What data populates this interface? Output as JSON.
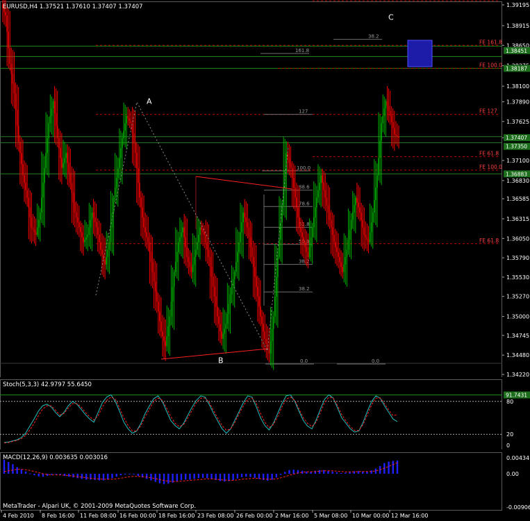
{
  "window": {
    "symbol_header": "EURUSD,H4  1.37521 1.37610 1.37407 1.37407",
    "copyright": "MetaTrader - Alpari UK, © 2001-2009 MetaQuotes Software Corp."
  },
  "colors": {
    "background": "#000000",
    "bull_candle": "#00b000",
    "bear_candle": "#ff0000",
    "grid": "#2a3a2a",
    "fib_red": "#c00000",
    "fib_gray": "#707070",
    "pattern_line": "#ff2020",
    "stoch_main": "#20c0c0",
    "stoch_signal": "#ff2020",
    "macd_hist": "#2020ff",
    "macd_signal": "#ff2020",
    "zone_box": "#1c1ca8",
    "axis_text": "#ffffff",
    "highlight_line": "#1e8c1e",
    "price_tag": "#1c6d1c"
  },
  "chart_data": [
    {
      "type": "candlestick",
      "title": "EURUSD,H4",
      "ohlc": {
        "open": 1.37521,
        "high": 1.3761,
        "low": 1.37407,
        "close": 1.37407
      },
      "ylim": [
        1.341,
        1.396
      ],
      "y_ticks": [
        "1.39195",
        "1.38915",
        "1.38650",
        "1.38375",
        "1.38100",
        "1.37890",
        "1.37625",
        "1.37407",
        "1.37100",
        "1.36830",
        "1.36585",
        "1.36315",
        "1.36050",
        "1.35790",
        "1.35530",
        "1.35270",
        "1.35000",
        "1.34745",
        "1.34480",
        "1.34220"
      ],
      "x_ticks": [
        "4 Feb 2010",
        "8 Feb 16:00",
        "11 Feb 08:00",
        "16 Feb 00:00",
        "18 Feb 16:00",
        "23 Feb 08:00",
        "26 Feb 00:00",
        "2 Mar 16:00",
        "5 Mar 08:00",
        "10 Mar 00:00",
        "12 Mar 16:00"
      ],
      "price_tags": [
        {
          "label": "1.38451",
          "price": 1.3858
        },
        {
          "label": "1.38187",
          "price": 1.3834
        },
        {
          "label": "1.37407",
          "price": 1.37407
        },
        {
          "label": "1.37350",
          "price": 1.3729
        },
        {
          "label": "1.36883",
          "price": 1.3692
        }
      ],
      "wave_labels": [
        {
          "label": "A",
          "price": 1.379
        },
        {
          "label": "B",
          "price": 1.3441
        },
        {
          "label": "C",
          "price": 1.3903
        }
      ],
      "fe_levels": [
        {
          "label": "FE 127",
          "price": 1.3925
        },
        {
          "label": "FE 161.8",
          "price": 1.3865
        },
        {
          "label": "FE 100.0",
          "price": 1.3834
        },
        {
          "label": "FE 127",
          "price": 1.3772
        },
        {
          "label": "FE 61.8",
          "price": 1.3715
        },
        {
          "label": "FE 100.0",
          "price": 1.3697
        },
        {
          "label": "FE 61.8",
          "price": 1.3598
        }
      ],
      "fib_labels": [
        {
          "label": "38.2",
          "price": 1.3874
        },
        {
          "label": "161.8",
          "price": 1.3855
        },
        {
          "label": "127",
          "price": 1.3773
        },
        {
          "label": "100.0",
          "price": 1.3697
        },
        {
          "label": "88.6",
          "price": 1.3671
        },
        {
          "label": "78.6",
          "price": 1.3649
        },
        {
          "label": "61.8",
          "price": 1.3621
        },
        {
          "label": "50.0",
          "price": 1.3598
        },
        {
          "label": "38.2",
          "price": 1.3571
        },
        {
          "label": "38.2",
          "price": 1.3534
        },
        {
          "label": "0.0",
          "price": 1.3437
        },
        {
          "label": "0.0",
          "price": 1.3437
        }
      ],
      "series": [
        {
          "name": "EURUSD,H4",
          "close": [
            1.3905,
            1.384,
            1.38,
            1.3735,
            1.369,
            1.366,
            1.362,
            1.361,
            1.364,
            1.37,
            1.376,
            1.379,
            1.374,
            1.37,
            1.372,
            1.368,
            1.364,
            1.362,
            1.36,
            1.361,
            1.364,
            1.362,
            1.359,
            1.357,
            1.36,
            1.366,
            1.37,
            1.374,
            1.377,
            1.376,
            1.372,
            1.366,
            1.362,
            1.36,
            1.356,
            1.352,
            1.348,
            1.346,
            1.35,
            1.356,
            1.36,
            1.362,
            1.358,
            1.356,
            1.359,
            1.362,
            1.361,
            1.358,
            1.354,
            1.35,
            1.347,
            1.349,
            1.353,
            1.356,
            1.36,
            1.364,
            1.362,
            1.358,
            1.354,
            1.35,
            1.347,
            1.345,
            1.35,
            1.358,
            1.365,
            1.372,
            1.37,
            1.366,
            1.362,
            1.36,
            1.358,
            1.362,
            1.366,
            1.369,
            1.366,
            1.363,
            1.36,
            1.358,
            1.356,
            1.359,
            1.363,
            1.366,
            1.364,
            1.361,
            1.36,
            1.364,
            1.369,
            1.376,
            1.379,
            1.377,
            1.3745,
            1.3741
          ]
        }
      ]
    },
    {
      "type": "line",
      "title": "Stoch(5,3,3) 42.9797 55.6450",
      "ylim": [
        0,
        100
      ],
      "y_ticks": [
        "91.7431",
        "80",
        "20",
        "0"
      ],
      "series": [
        {
          "name": "Stoch main",
          "values": [
            5,
            6,
            8,
            10,
            14,
            22,
            35,
            48,
            62,
            72,
            75,
            70,
            60,
            52,
            60,
            72,
            80,
            75,
            66,
            56,
            48,
            42,
            60,
            78,
            88,
            92,
            80,
            62,
            42,
            30,
            22,
            26,
            40,
            58,
            72,
            85,
            90,
            80,
            62,
            45,
            36,
            30,
            40,
            55,
            70,
            82,
            90,
            88,
            74,
            58,
            44,
            30,
            22,
            30,
            46,
            62,
            78,
            90,
            88,
            70,
            50,
            36,
            28,
            40,
            58,
            76,
            90,
            92,
            80,
            62,
            45,
            35,
            30,
            46,
            66,
            84,
            92,
            86,
            68,
            50,
            40,
            30,
            24,
            26,
            42,
            62,
            80,
            90,
            86,
            72,
            60,
            48,
            43
          ]
        },
        {
          "name": "Stoch signal",
          "values": [
            4,
            5,
            7,
            9,
            12,
            18,
            28,
            40,
            54,
            66,
            72,
            72,
            64,
            55,
            58,
            68,
            76,
            76,
            70,
            60,
            52,
            46,
            54,
            70,
            82,
            88,
            84,
            68,
            50,
            36,
            26,
            26,
            36,
            52,
            66,
            80,
            86,
            82,
            68,
            52,
            40,
            34,
            38,
            50,
            64,
            78,
            86,
            86,
            78,
            63,
            49,
            36,
            27,
            30,
            42,
            58,
            72,
            84,
            86,
            76,
            58,
            42,
            32,
            38,
            52,
            70,
            84,
            88,
            82,
            66,
            50,
            40,
            34,
            42,
            60,
            78,
            88,
            86,
            72,
            56,
            44,
            34,
            27,
            27,
            38,
            56,
            74,
            86,
            86,
            76,
            64,
            54,
            56
          ]
        }
      ]
    },
    {
      "type": "bar",
      "title": "MACD(12,26,9) 0.003635 0.003016",
      "ylim": [
        -0.00906,
        0.00434
      ],
      "y_ticks": [
        "0.004341",
        "0.00",
        "-0.00906"
      ],
      "series": [
        {
          "name": "MACD histogram",
          "values": [
            0.0038,
            0.0032,
            0.0026,
            0.0018,
            0.0012,
            0.0006,
            0.0001,
            -0.0004,
            -0.0007,
            -0.0008,
            -0.0006,
            -0.0003,
            -0.0002,
            -0.0004,
            -0.0006,
            -0.0008,
            -0.001,
            -0.0012,
            -0.0014,
            -0.0016,
            -0.0016,
            -0.0017,
            -0.0018,
            -0.0018,
            -0.0016,
            -0.0012,
            -0.0008,
            -0.0004,
            -0.0001,
            0.0,
            -0.0002,
            -0.0006,
            -0.001,
            -0.0014,
            -0.0018,
            -0.0022,
            -0.0026,
            -0.0028,
            -0.0027,
            -0.0024,
            -0.002,
            -0.0017,
            -0.0016,
            -0.0016,
            -0.0014,
            -0.0012,
            -0.0011,
            -0.0012,
            -0.0014,
            -0.0017,
            -0.002,
            -0.0021,
            -0.002,
            -0.0017,
            -0.0013,
            -0.0009,
            -0.0008,
            -0.0009,
            -0.0011,
            -0.0014,
            -0.0017,
            -0.0019,
            -0.0016,
            -0.001,
            -0.0003,
            0.0005,
            0.001,
            0.0011,
            0.001,
            0.0008,
            0.0006,
            0.0006,
            0.0008,
            0.001,
            0.001,
            0.0008,
            0.0006,
            0.0004,
            0.0002,
            0.0003,
            0.0005,
            0.0007,
            0.0007,
            0.0006,
            0.0006,
            0.0009,
            0.0014,
            0.0021,
            0.0029,
            0.0033,
            0.0035,
            0.0036
          ]
        },
        {
          "name": "MACD signal",
          "values": [
            0.0006,
            0.0008,
            0.001,
            0.0012,
            0.0012,
            0.0011,
            0.0009,
            0.0006,
            0.0003,
            0.0,
            -0.0002,
            -0.0003,
            -0.0003,
            -0.0003,
            -0.0004,
            -0.0005,
            -0.0006,
            -0.0008,
            -0.0009,
            -0.0011,
            -0.0012,
            -0.0013,
            -0.0014,
            -0.0015,
            -0.0015,
            -0.0015,
            -0.0014,
            -0.0012,
            -0.001,
            -0.0008,
            -0.0007,
            -0.0007,
            -0.0008,
            -0.0009,
            -0.0011,
            -0.0013,
            -0.0016,
            -0.0018,
            -0.002,
            -0.0021,
            -0.0021,
            -0.002,
            -0.0019,
            -0.0018,
            -0.0017,
            -0.0016,
            -0.0015,
            -0.0014,
            -0.0014,
            -0.0015,
            -0.0016,
            -0.0017,
            -0.0018,
            -0.0018,
            -0.0017,
            -0.0015,
            -0.0014,
            -0.0013,
            -0.0012,
            -0.0013,
            -0.0014,
            -0.0015,
            -0.0015,
            -0.0014,
            -0.0011,
            -0.0008,
            -0.0004,
            -0.0001,
            0.0002,
            0.0004,
            0.0005,
            0.0005,
            0.0006,
            0.0007,
            0.0008,
            0.0008,
            0.0008,
            0.0007,
            0.0006,
            0.0005,
            0.0005,
            0.0005,
            0.0006,
            0.0006,
            0.0006,
            0.0006,
            0.0008,
            0.0011,
            0.0015,
            0.002,
            0.0025,
            0.003
          ]
        }
      ]
    }
  ]
}
